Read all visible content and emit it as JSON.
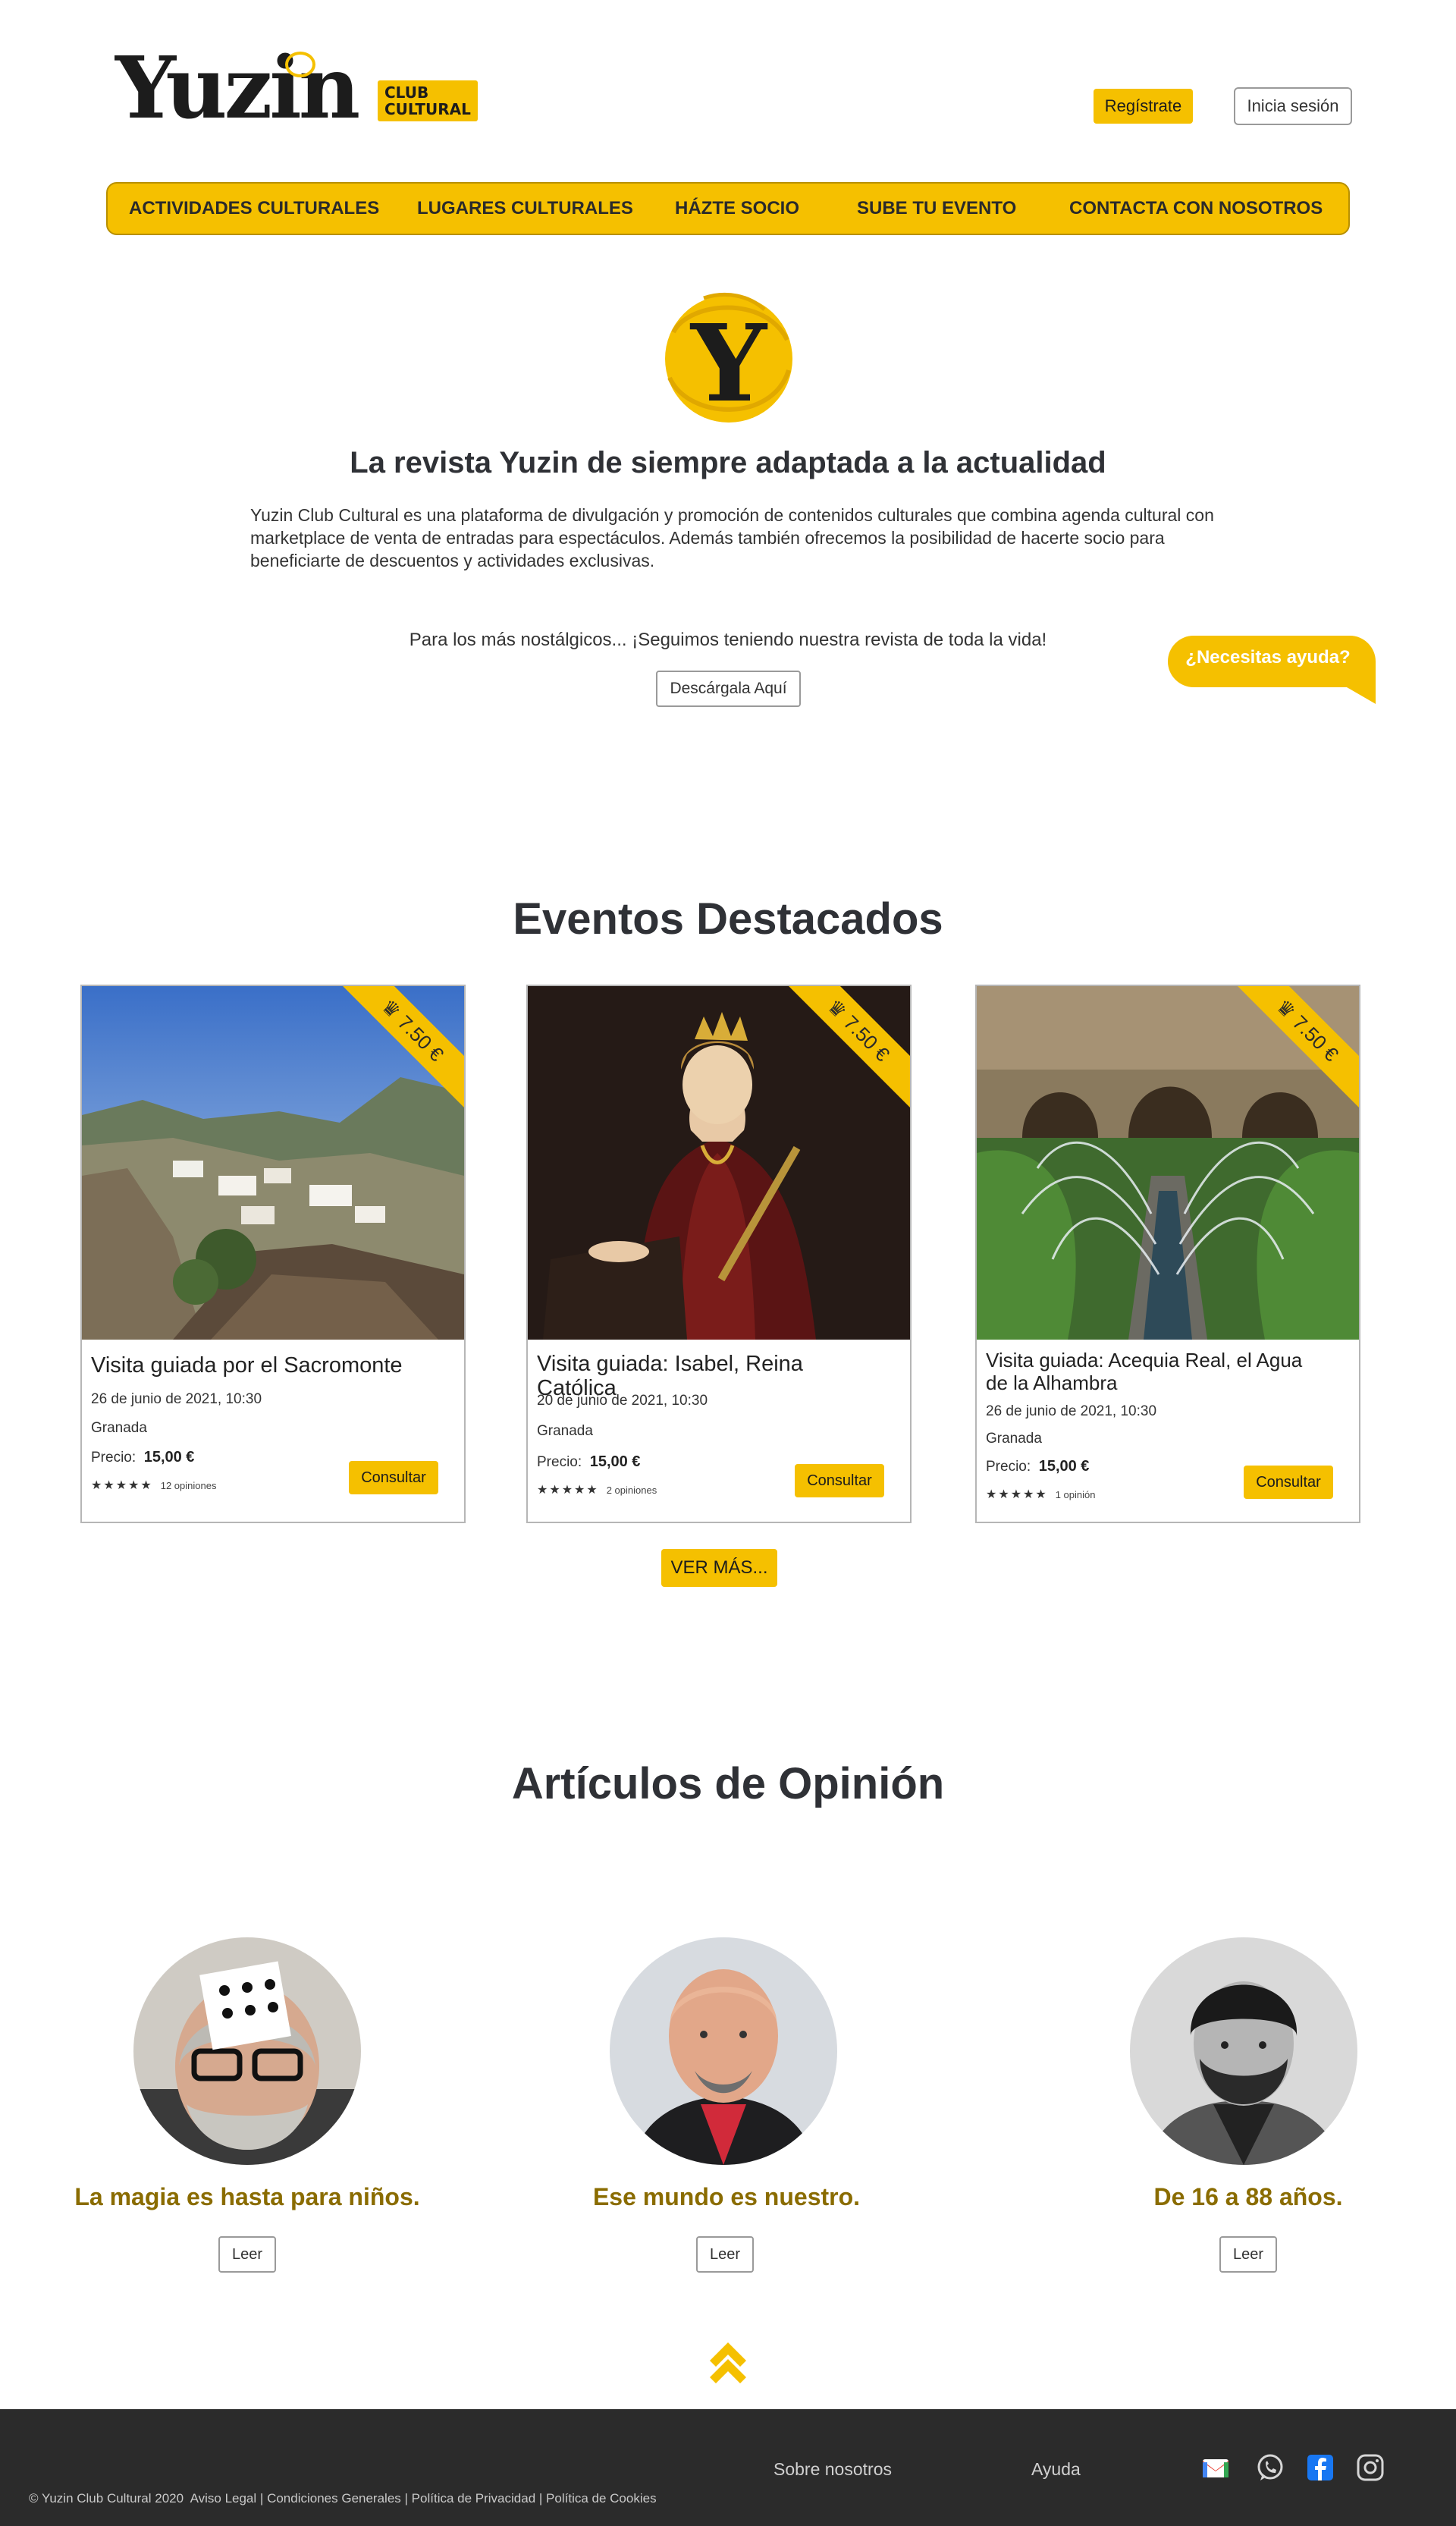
{
  "header": {
    "logo_text": "Yuzin",
    "logo_badge": "CLUB CULTURAL",
    "register_label": "Regístrate",
    "login_label": "Inicia sesión"
  },
  "nav": {
    "items": [
      "ACTIVIDADES CULTURALES",
      "LUGARES CULTURALES",
      "HÁZTE SOCIO",
      "SUBE TU EVENTO",
      "CONTACTA CON NOSOTROS"
    ]
  },
  "hero": {
    "logo_letter": "Y",
    "title": "La revista Yuzin de siempre adaptada a la actualidad",
    "description": "Yuzin Club Cultural es una plataforma de divulgación y promoción de  contenidos culturales que combina agenda cultural con marketplace de venta de entradas para espectáculos. Además también ofrecemos la posibilidad de hacerte socio para beneficiarte de descuentos y actividades exclusivas.",
    "nostalgia": "Para los más nostálgicos... ¡Seguimos teniendo nuestra revista de toda la vida!",
    "download_label": "Descárgala Aquí"
  },
  "help_bubble": "¿Necesitas ayuda?",
  "events": {
    "title": "Eventos Destacados",
    "price_label": "Precio:",
    "consult_label": "Consultar",
    "more_label": "VER MÁS...",
    "items": [
      {
        "ribbon": "7.50 €",
        "title": "Visita guiada por el Sacromonte",
        "date": "26 de junio de 2021, 10:30",
        "city": "Granada",
        "price": "15,00 €",
        "stars": "★★★★★",
        "reviews": "12 opiniones"
      },
      {
        "ribbon": "7.50 €",
        "title": "Visita guiada: Isabel, Reina Católica",
        "date": "20 de junio de 2021, 10:30",
        "city": "Granada",
        "price": "15,00 €",
        "stars": "★★★★★",
        "reviews": "2 opiniones"
      },
      {
        "ribbon": "7.50 €",
        "title": "Visita guiada: Acequia Real, el Agua de la Alhambra",
        "date": "26 de junio de 2021, 10:30",
        "city": "Granada",
        "price": "15,00 €",
        "stars": "★★★★★",
        "reviews": "1 opinión"
      }
    ]
  },
  "opinion": {
    "title": "Artículos de Opinión",
    "read_label": "Leer",
    "items": [
      {
        "title": "La magia es hasta para niños."
      },
      {
        "title": "Ese mundo es nuestro."
      },
      {
        "title": "De 16 a 88 años."
      }
    ]
  },
  "footer": {
    "about": "Sobre nosotros",
    "help": "Ayuda",
    "copyright": "© Yuzin Club Cultural 2020",
    "legal": "Aviso Legal",
    "terms": "Condiciones Generales",
    "privacy": "Política de Privacidad",
    "cookies": "Política de Cookies",
    "separator": "|"
  },
  "colors": {
    "brand_yellow": "#f5c000",
    "dark_text": "#2f3136",
    "opinion_title": "#8a6c00",
    "footer_bg": "#2b2b2b"
  },
  "icons": [
    "gmail-icon",
    "whatsapp-icon",
    "facebook-icon",
    "instagram-icon",
    "double-chevron-up-icon",
    "price-ribbon-icon"
  ]
}
